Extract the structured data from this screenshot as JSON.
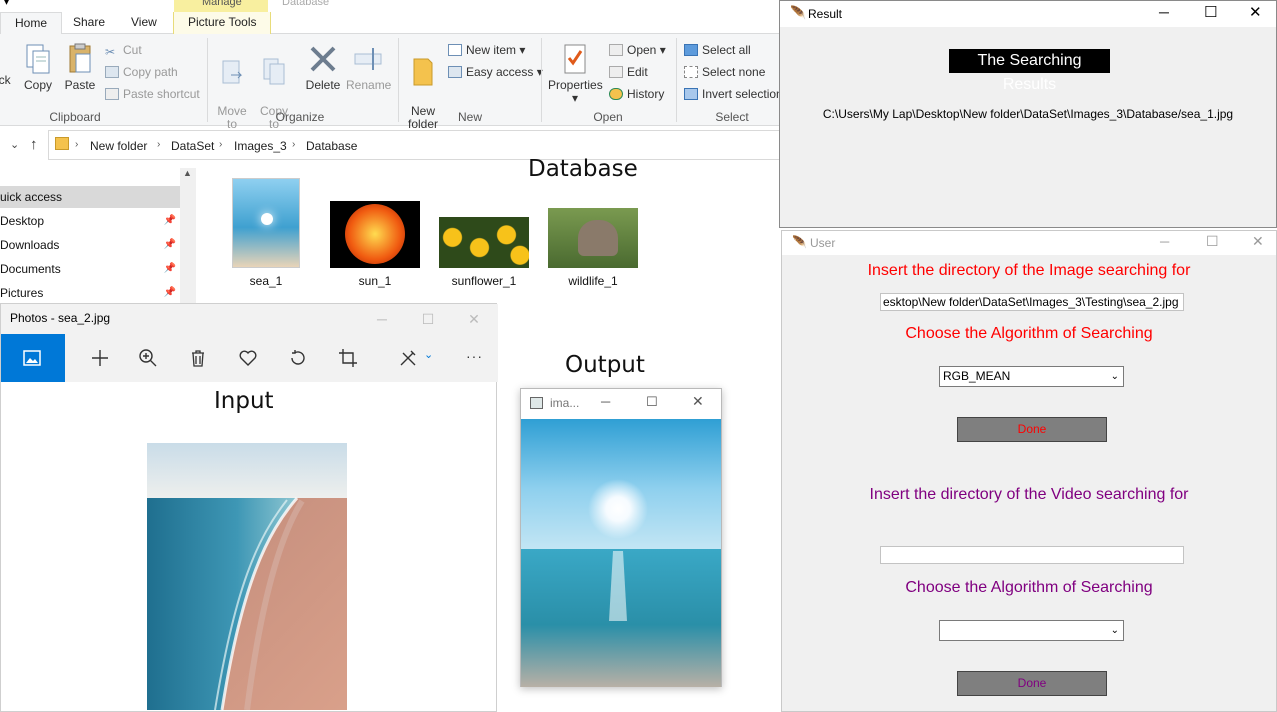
{
  "explorer": {
    "tabs": [
      "Home",
      "Share",
      "View",
      "Picture Tools"
    ],
    "context_tab": "Manage",
    "window_title_partial": "Database",
    "clipboard": {
      "pin_label": "ick",
      "copy": "Copy",
      "paste": "Paste",
      "cut": "Cut",
      "copy_path": "Copy path",
      "paste_shortcut": "Paste shortcut",
      "group": "Clipboard"
    },
    "organize": {
      "move_to": "Move\nto",
      "copy_to": "Copy\nto",
      "delete": "Delete",
      "rename": "Rename",
      "group": "Organize"
    },
    "new": {
      "new_folder": "New\nfolder",
      "new_item": "New item",
      "easy_access": "Easy access",
      "group": "New"
    },
    "open": {
      "properties": "Properties",
      "open": "Open",
      "edit": "Edit",
      "history": "History",
      "group": "Open"
    },
    "select": {
      "select_all": "Select all",
      "select_none": "Select none",
      "invert": "Invert selection",
      "group": "Select"
    },
    "breadcrumbs": [
      "New folder",
      "DataSet",
      "Images_3",
      "Database"
    ],
    "nav": [
      {
        "label": "uick access",
        "pinned": false,
        "selected": true
      },
      {
        "label": "Desktop",
        "pinned": true
      },
      {
        "label": "Downloads",
        "pinned": true
      },
      {
        "label": "Documents",
        "pinned": true
      },
      {
        "label": "Pictures",
        "pinned": true
      }
    ],
    "files": [
      "sea_1",
      "sun_1",
      "sunflower_1",
      "wildlife_1"
    ]
  },
  "annotations": {
    "database": "Database",
    "output": "Output",
    "input": "Input"
  },
  "photos": {
    "title": "Photos - sea_2.jpg"
  },
  "image_window": {
    "title": "ima..."
  },
  "result": {
    "title": "Result",
    "heading": "The Searching Results",
    "path": "C:\\Users\\My Lap\\Desktop\\New folder\\DataSet\\Images_3\\Database/sea_1.jpg"
  },
  "user": {
    "title": "User",
    "image_label": "Insert the directory of the Image searching for",
    "image_path": "esktop\\New folder\\DataSet\\Images_3\\Testing\\sea_2.jpg",
    "algo_label_1": "Choose the Algorithm of Searching",
    "algo_value_1": "RGB_MEAN",
    "done_1": "Done",
    "video_label": "Insert the directory of the Video searching for",
    "video_path": "",
    "algo_label_2": "Choose the Algorithm of Searching",
    "algo_value_2": "",
    "done_2": "Done",
    "colors": {
      "image": "#ff0000",
      "video": "#800080",
      "button": "#7f7f7f"
    }
  }
}
